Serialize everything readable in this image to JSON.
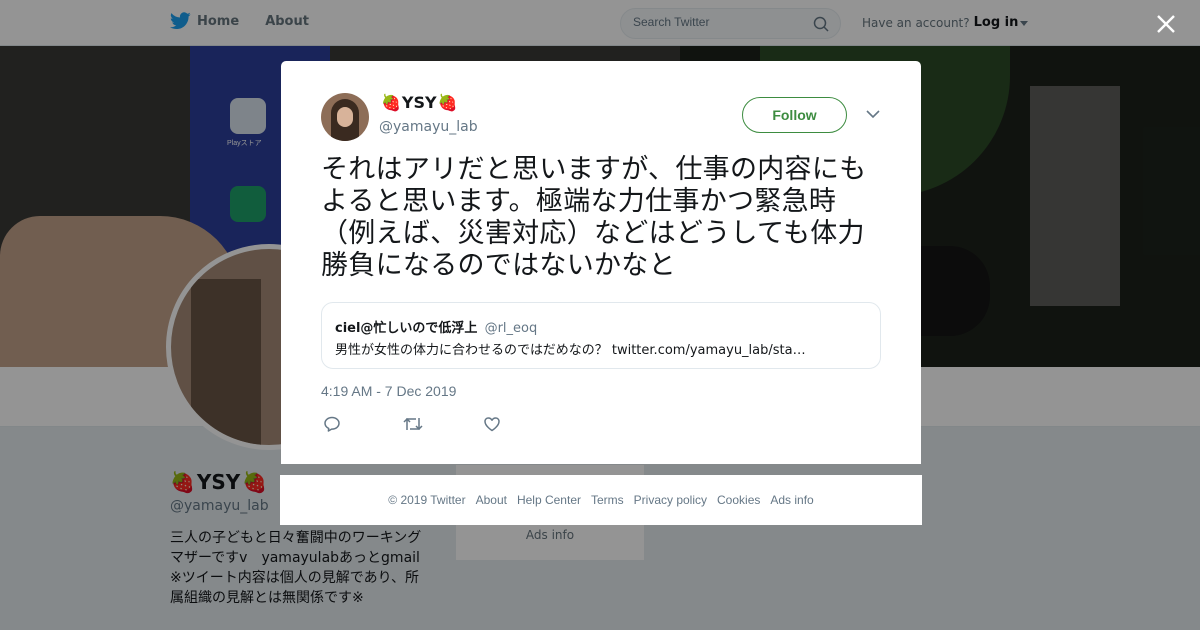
{
  "nav": {
    "home_label": "Home",
    "about_label": "About",
    "search_placeholder": "Search Twitter",
    "account_prompt": "Have an account?",
    "login_label": "Log in"
  },
  "banner": {
    "app_label": "Playストア"
  },
  "profile": {
    "name": "YSY",
    "name_emoji": "🍓",
    "handle": "@yamayu_lab",
    "bio_lines": [
      "三人の子どもと日々奮闘中のワーキング",
      "マザーですv　yamayulabあっとgmail",
      "※ツイート内容は個人の見解であり、所",
      "属組織の見解とは無関係です※"
    ],
    "sidecard_ads": "Ads info"
  },
  "tweet": {
    "name": "YSY",
    "handle": "@yamayu_lab",
    "follow_label": "Follow",
    "text_lines": [
      "それはアリだと思いますが、仕事の内容にも",
      "よると思います。極端な力仕事かつ緊急時",
      "（例えば、災害対応）などはどうしても体力",
      "勝負になるのではないかなと"
    ],
    "quote": {
      "name": "ciel@忙しいので低浮上",
      "handle": "@rl_eoq",
      "text": "男性が女性の体力に合わせるのではだめなの？ twitter.com/yamayu_lab/sta…"
    },
    "timestamp": "4:19 AM - 7 Dec 2019"
  },
  "footer": {
    "links": [
      "© 2019 Twitter",
      "About",
      "Help Center",
      "Terms",
      "Privacy policy",
      "Cookies",
      "Ads info"
    ]
  },
  "icons": {
    "logo": "twitter-bird-icon",
    "home": "twitter-bird-icon",
    "search": "search-icon",
    "caret": "caret-down-icon",
    "close": "close-icon",
    "more": "chevron-down-icon",
    "reply": "reply-icon",
    "retweet": "retweet-icon",
    "like": "heart-icon"
  },
  "colors": {
    "twitter_blue": "#1da1f2",
    "follow_green": "#3d8c40",
    "secondary_text": "#657786",
    "strawberry_red": "#e0245e"
  }
}
